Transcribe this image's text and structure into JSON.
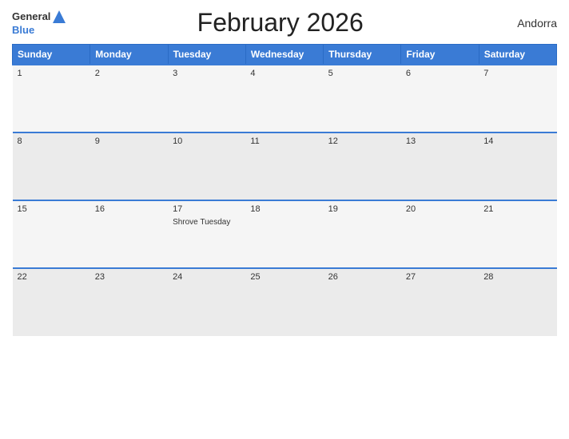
{
  "header": {
    "title": "February 2026",
    "country": "Andorra",
    "logo_general": "General",
    "logo_blue": "Blue"
  },
  "calendar": {
    "days_of_week": [
      "Sunday",
      "Monday",
      "Tuesday",
      "Wednesday",
      "Thursday",
      "Friday",
      "Saturday"
    ],
    "weeks": [
      [
        {
          "date": "1",
          "events": []
        },
        {
          "date": "2",
          "events": []
        },
        {
          "date": "3",
          "events": []
        },
        {
          "date": "4",
          "events": []
        },
        {
          "date": "5",
          "events": []
        },
        {
          "date": "6",
          "events": []
        },
        {
          "date": "7",
          "events": []
        }
      ],
      [
        {
          "date": "8",
          "events": []
        },
        {
          "date": "9",
          "events": []
        },
        {
          "date": "10",
          "events": []
        },
        {
          "date": "11",
          "events": []
        },
        {
          "date": "12",
          "events": []
        },
        {
          "date": "13",
          "events": []
        },
        {
          "date": "14",
          "events": []
        }
      ],
      [
        {
          "date": "15",
          "events": []
        },
        {
          "date": "16",
          "events": []
        },
        {
          "date": "17",
          "events": [
            "Shrove Tuesday"
          ]
        },
        {
          "date": "18",
          "events": []
        },
        {
          "date": "19",
          "events": []
        },
        {
          "date": "20",
          "events": []
        },
        {
          "date": "21",
          "events": []
        }
      ],
      [
        {
          "date": "22",
          "events": []
        },
        {
          "date": "23",
          "events": []
        },
        {
          "date": "24",
          "events": []
        },
        {
          "date": "25",
          "events": []
        },
        {
          "date": "26",
          "events": []
        },
        {
          "date": "27",
          "events": []
        },
        {
          "date": "28",
          "events": []
        }
      ]
    ]
  }
}
